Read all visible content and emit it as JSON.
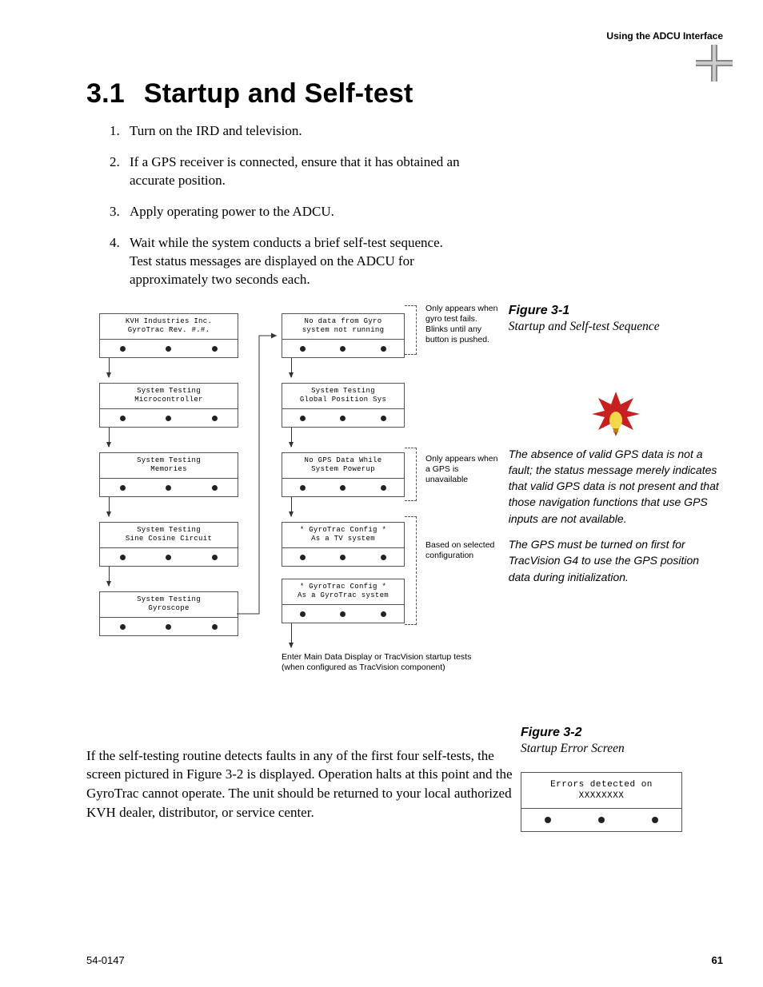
{
  "header": {
    "section": "Using the ADCU Interface"
  },
  "title": {
    "number": "3.1",
    "text": "Startup and Self-test"
  },
  "steps": [
    "Turn on the IRD and television.",
    "If a GPS receiver is connected, ensure that it has obtained an accurate position.",
    "Apply operating power to the ADCU.",
    "Wait while the system conducts a brief self-test sequence. Test status messages are displayed on the ADCU for approximately two seconds each."
  ],
  "fig1": {
    "label": "Figure 3-1",
    "caption": "Startup and Self-test Sequence"
  },
  "tip": {
    "p1": "The absence of valid GPS data is not a fault; the status message merely indicates that valid GPS data is not present and that those navigation functions that use GPS inputs are not available.",
    "p2": "The GPS must be turned on first for TracVision G4 to use the GPS position data during initialization."
  },
  "flow": {
    "left": [
      {
        "l1": "KVH Industries Inc.",
        "l2": "GyroTrac Rev. #.#."
      },
      {
        "l1": "System Testing",
        "l2": "Microcontroller"
      },
      {
        "l1": "System Testing",
        "l2": "Memories"
      },
      {
        "l1": "System Testing",
        "l2": "Sine Cosine Circuit"
      },
      {
        "l1": "System Testing",
        "l2": "Gyroscope"
      }
    ],
    "right": [
      {
        "l1": "No data from Gyro",
        "l2": "system not running"
      },
      {
        "l1": "System Testing",
        "l2": "Global Position Sys"
      },
      {
        "l1": "No GPS Data While",
        "l2": "System Powerup"
      },
      {
        "l1": "* GyroTrac Config *",
        "l2": "As a TV system"
      },
      {
        "l1": "* GyroTrac Config *",
        "l2": "As a GyroTrac system"
      }
    ],
    "ann": {
      "a1": "Only appears when gyro test fails. Blinks until any button is pushed.",
      "a2": "Only appears when a GPS is unavailable",
      "a3": "Based on selected configuration"
    },
    "exit": "Enter Main Data Display or TracVision startup tests\n(when configured as TracVision component)"
  },
  "para2": "If the self-testing routine detects faults in any of the first four self-tests, the screen pictured in Figure 3-2 is displayed. Operation halts at this point and the GyroTrac cannot operate. The unit should be returned to your local authorized KVH dealer, distributor, or service center.",
  "fig2": {
    "label": "Figure 3-2",
    "caption": "Startup Error Screen",
    "screen": {
      "l1": "Errors detected on",
      "l2": "XXXXXXXX"
    }
  },
  "footer": {
    "doc": "54-0147",
    "page": "61"
  }
}
